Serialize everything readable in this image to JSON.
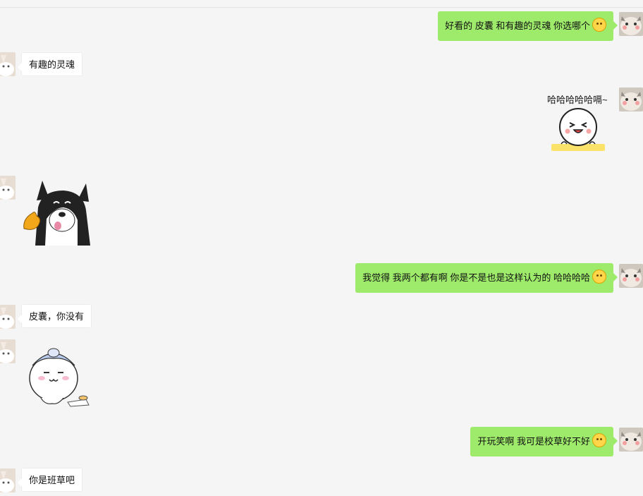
{
  "messages": [
    {
      "side": "right",
      "text": "好看的 皮囊 和有趣的灵魂 你选哪个",
      "emoji": "thinking-emoji"
    },
    {
      "side": "left",
      "text": "有趣的灵魂"
    },
    {
      "side": "right",
      "sticker": "laughing-blob-sticker",
      "caption": "哈哈哈哈哈嗝~"
    },
    {
      "side": "left",
      "sticker": "husky-dog-sticker"
    },
    {
      "side": "right",
      "text": "我觉得 我两个都有啊 你是不是也是这样认为的 哈哈哈哈",
      "emoji": "grinning-emoji"
    },
    {
      "side": "left",
      "text": "皮囊，你没有"
    },
    {
      "side": "left",
      "sticker": "chubby-cat-sticker"
    },
    {
      "side": "right",
      "text": "开玩笑啊 我可是校草好不好",
      "emoji": "surprised-emoji"
    },
    {
      "side": "left",
      "text": "你是班草吧"
    }
  ],
  "colors": {
    "sent_bubble": "#9eea6a",
    "received_bubble": "#ffffff",
    "background": "#f5f5f5"
  }
}
